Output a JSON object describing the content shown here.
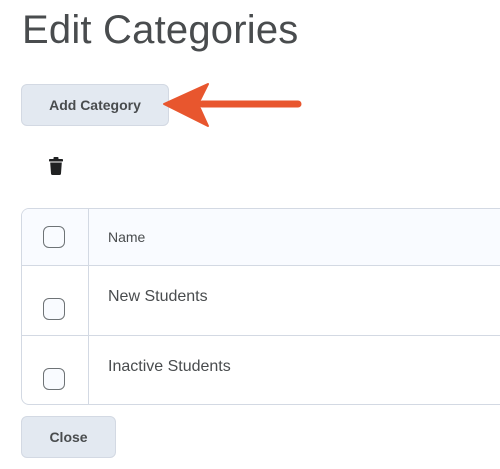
{
  "page": {
    "title": "Edit Categories"
  },
  "toolbar": {
    "add_label": "Add Category",
    "delete_icon": "trash-icon"
  },
  "table": {
    "header": {
      "name_label": "Name"
    },
    "rows": [
      {
        "name": "New Students",
        "checked": false
      },
      {
        "name": "Inactive Students",
        "checked": false
      }
    ]
  },
  "footer": {
    "close_label": "Close"
  },
  "annotation": {
    "arrow_color": "#e8562e"
  },
  "colors": {
    "button_bg": "#e3e9f1",
    "border": "#d3d9e3",
    "text": "#494c4e"
  }
}
